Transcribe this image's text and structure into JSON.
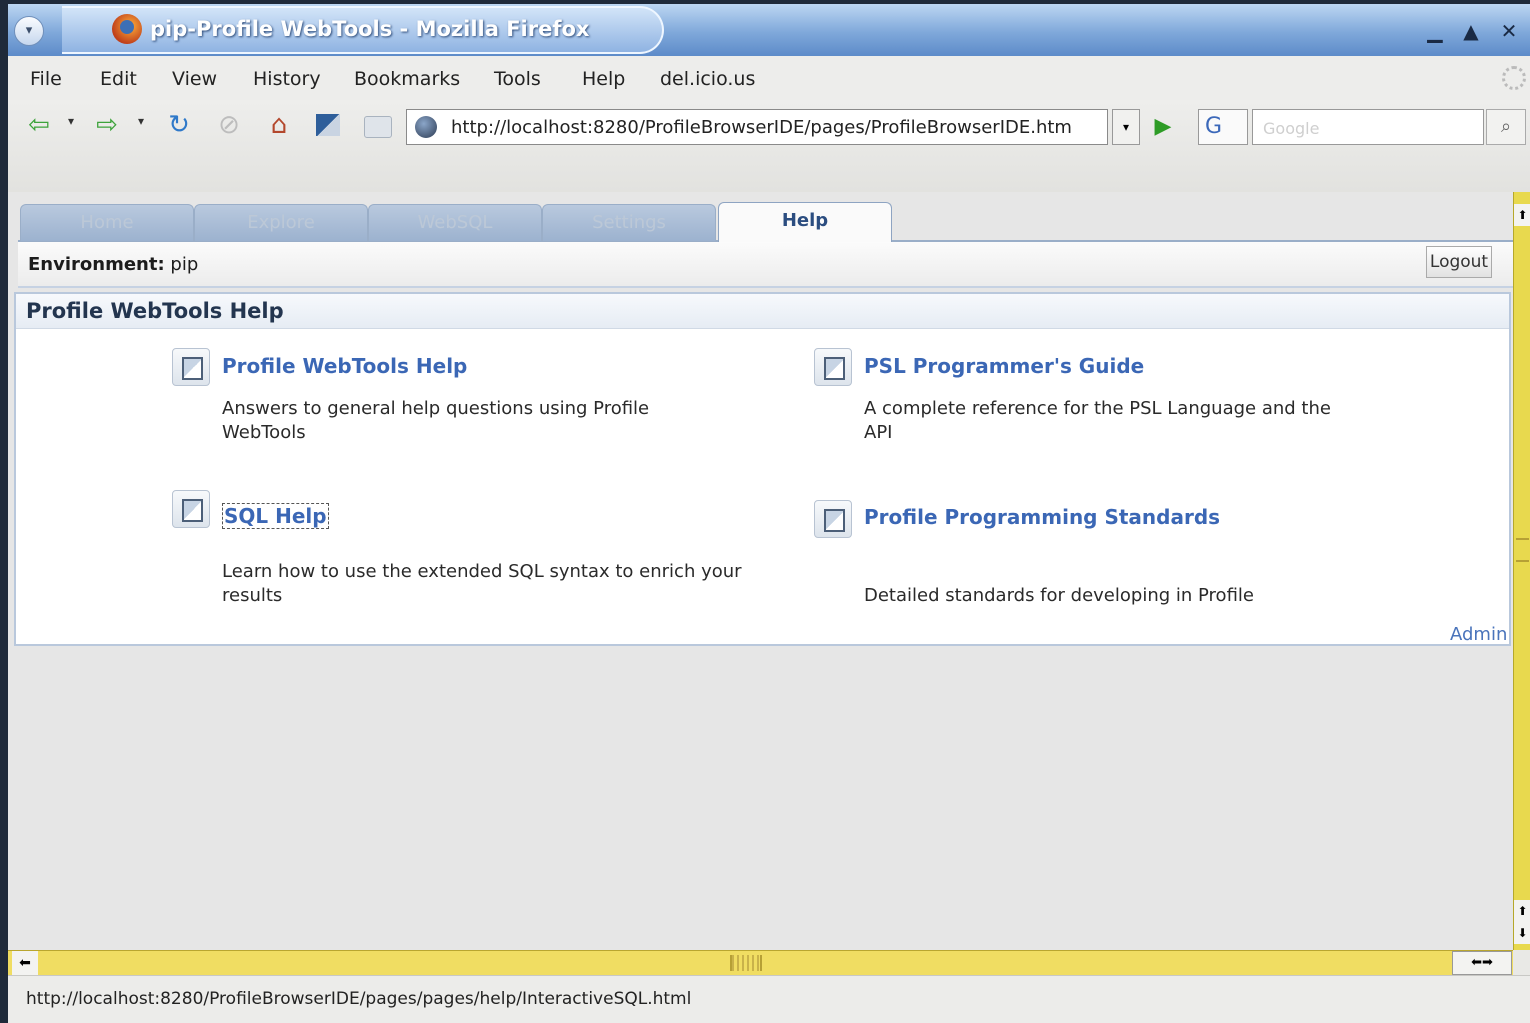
{
  "window": {
    "title": "pip-Profile WebTools - Mozilla Firefox",
    "menu_glyph": "▾",
    "minimize_glyph": "▁",
    "maximize_glyph": "▲",
    "close_glyph": "✕"
  },
  "menubar": {
    "items": [
      "File",
      "Edit",
      "View",
      "History",
      "Bookmarks",
      "Tools",
      "Help",
      "del.icio.us"
    ]
  },
  "navbar": {
    "back_glyph": "⇦",
    "forward_glyph": "⇨",
    "dropdown_glyph": "▾",
    "reload_glyph": "↻",
    "stop_glyph": "⊘",
    "home_glyph": "⌂",
    "url": "http://localhost:8280/ProfileBrowserIDE/pages/ProfileBrowserIDE.htm",
    "go_glyph": "▶",
    "search_engine_glyph": "G",
    "search_placeholder": "Google",
    "search_glyph": "⌕"
  },
  "app": {
    "tabs": [
      {
        "label": "Home",
        "active": false
      },
      {
        "label": "Explore",
        "active": false
      },
      {
        "label": "WebSQL",
        "active": false
      },
      {
        "label": "Settings",
        "active": false
      },
      {
        "label": "Help",
        "active": true
      }
    ],
    "environment_label": "Environment:",
    "environment_value": "pip",
    "logout_label": "Logout",
    "panel_title": "Profile WebTools Help",
    "help_items": [
      {
        "title": "Profile WebTools Help",
        "description": "Answers to general help questions using Profile WebTools"
      },
      {
        "title": "PSL Programmer's Guide",
        "description": "A complete reference for the PSL Language and the API"
      },
      {
        "title": "SQL Help",
        "description": "Learn how to use the extended SQL syntax to enrich your results"
      },
      {
        "title": "Profile Programming Standards",
        "description": "Detailed standards for developing in Profile"
      }
    ],
    "admin_label": "Admin"
  },
  "scrollbars": {
    "up_glyph": "⬆",
    "down_glyph": "⬇",
    "left_glyph": "⬅",
    "right_glyph": "⬅➡"
  },
  "statusbar": {
    "text": "http://localhost:8280/ProfileBrowserIDE/pages/pages/help/InteractiveSQL.html"
  }
}
